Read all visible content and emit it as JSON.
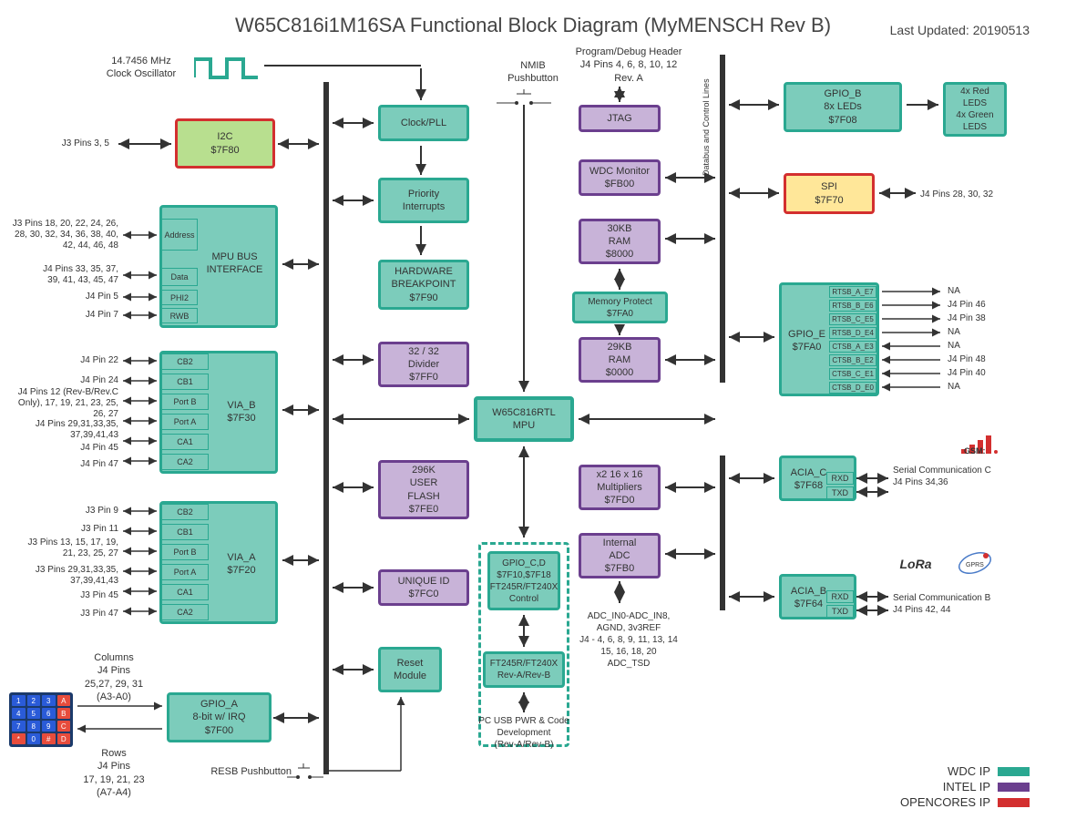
{
  "title": "W65C816i1M16SA Functional Block Diagram (MyMENSCH Rev B)",
  "updated": "Last Updated: 20190513",
  "clock_label": "14.7456 MHz\nClock Oscillator",
  "nmi": "NMIB\nPushbutton",
  "prog_hdr": "Program/Debug Header\nJ4 Pins 4, 6, 8, 10, 12\nRev. A",
  "dbus_label": "Databus and Control Lines",
  "i2c": "I2C\n$7F80",
  "i2c_pins": "J3 Pins 3, 5",
  "clockpll": "Clock/PLL",
  "priority": "Priority\nInterrupts",
  "hwbp": "HARDWARE\nBREAKPOINT\n$7F90",
  "divider": "32 / 32\nDivider\n$7FF0",
  "userflash": "296K\nUSER\nFLASH\n$7FE0",
  "uniqueid": "UNIQUE ID\n$7FC0",
  "reset": "Reset\nModule",
  "resb": "RESB Pushbutton",
  "jtag": "JTAG",
  "wdcmon": "WDC Monitor\n$FB00",
  "ram30": "30KB\nRAM\n$8000",
  "memprot": "Memory Protect\n$7FA0",
  "ram29": "29KB\nRAM\n$0000",
  "mpu": "W65C816RTL\nMPU",
  "mult": "x2 16 x 16\nMultipliers\n$7FD0",
  "iadc": "Internal\nADC\n$7FB0",
  "gpiocd": "GPIO_C,D\n$7F10,$7F18\nFT245R/FT240X\nControl",
  "ft245": "FT245R/FT240X\nRev-A/Rev-B",
  "usbpwr": "PC USB PWR & Code\nDevelopment\n(Rev-A/Rev-B)",
  "adc_pins": "ADC_IN0-ADC_IN8,\nAGND, 3v3REF\nJ4 - 4, 6, 8, 9, 11, 13, 14\n15, 16, 18, 20\nADC_TSD",
  "gpiob": "GPIO_B\n8x LEDs\n$7F08",
  "leds": "4x Red\nLEDS\n4x Green\nLEDS",
  "spi": "SPI\n$7F70",
  "spi_pins": "J4 Pins 28, 30, 32",
  "gpioe": "GPIO_E\n$7FA0",
  "gpioe_sigs": [
    "RTSB_A_E7",
    "RTSB_B_E6",
    "RTSB_C_E5",
    "RTSB_D_E4",
    "CTSB_A_E3",
    "CTSB_B_E2",
    "CTSB_C_E1",
    "CTSB_D_E0"
  ],
  "gpioe_pins": [
    "NA",
    "J4 Pin 46",
    "J4 Pin 38",
    "NA",
    "NA",
    "J4 Pin 48",
    "J4 Pin 40",
    "NA"
  ],
  "aciac": "ACIA_C\n$7F68",
  "aciac_label": "Serial Communication C\nJ4 Pins 34,36",
  "aciab": "ACIA_B\n$7F64",
  "aciab_label": "Serial Communication B\nJ4 Pins 42, 44",
  "rxd": "RXD",
  "txd": "TXD",
  "mpubus": "MPU BUS\nINTERFACE",
  "mpubus_sigs": [
    "Address",
    "Data",
    "PHI2",
    "RWB"
  ],
  "mpubus_pins": [
    "J3 Pins 18, 20, 22, 24, 26,\n28, 30, 32, 34, 36, 38, 40,\n42, 44, 46, 48",
    "J4 Pins 33, 35, 37,\n39, 41, 43, 45, 47",
    "J4 Pin 5",
    "J4 Pin 7"
  ],
  "viab": "VIA_B\n$7F30",
  "viab_sigs": [
    "CB2",
    "CB1",
    "Port B",
    "Port A",
    "CA1",
    "CA2"
  ],
  "viab_pins": [
    "J4 Pin 22",
    "J4 Pin 24",
    "J4 Pins 12 (Rev-B/Rev.C\nOnly), 17, 19, 21, 23, 25,\n26, 27",
    "J4 Pins 29,31,33,35,\n37,39,41,43",
    "J4 Pin 45",
    "J4 Pin 47"
  ],
  "viaa": "VIA_A\n$7F20",
  "viaa_sigs": [
    "CB2",
    "CB1",
    "Port B",
    "Port A",
    "CA1",
    "CA2"
  ],
  "viaa_pins": [
    "J3 Pin 9",
    "J3 Pin 11",
    "J3 Pins 13, 15, 17, 19,\n21, 23, 25, 27",
    "J3 Pins 29,31,33,35,\n37,39,41,43",
    "J3 Pin 45",
    "J3 Pin 47"
  ],
  "gpioa": "GPIO_A\n8-bit w/ IRQ\n$7F00",
  "cols": "Columns\nJ4 Pins\n25,27, 29, 31\n(A3-A0)",
  "rows": "Rows\nJ4 Pins\n17, 19, 21, 23\n(A7-A4)",
  "legend": {
    "wdc": "WDC IP",
    "intel": "INTEL IP",
    "oc": "OPENCORES IP"
  },
  "lora": "LoRa",
  "gprs": "GPRS",
  "gsm": "GSM"
}
